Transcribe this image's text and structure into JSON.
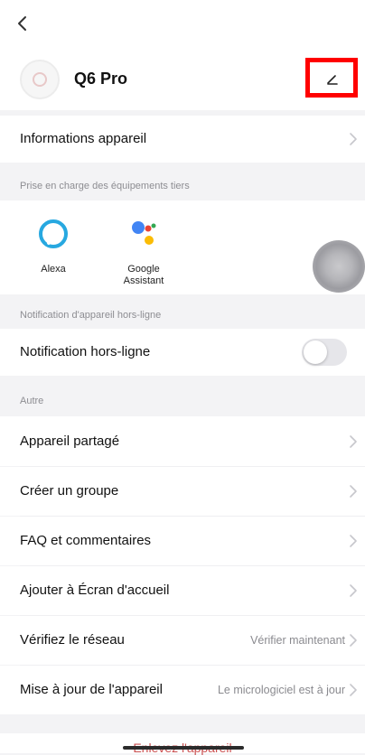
{
  "device": {
    "name": "Q6 Pro"
  },
  "rows": {
    "device_info": "Informations appareil"
  },
  "sections": {
    "third_party": "Prise en charge des équipements tiers",
    "offline": "Notification d'appareil hors-ligne",
    "other": "Autre"
  },
  "third_party_items": [
    {
      "label": "Alexa"
    },
    {
      "label": "Google\nAssistant"
    }
  ],
  "offline_notification": {
    "label": "Notification hors-ligne",
    "enabled": false
  },
  "other_rows": [
    {
      "label": "Appareil partagé",
      "value": ""
    },
    {
      "label": "Créer un groupe",
      "value": ""
    },
    {
      "label": "FAQ et commentaires",
      "value": ""
    },
    {
      "label": "Ajouter à Écran d'accueil",
      "value": ""
    },
    {
      "label": "Vérifiez le réseau",
      "value": "Vérifier maintenant"
    },
    {
      "label": "Mise à jour de l'appareil",
      "value": "Le micrologiciel est à jour"
    }
  ],
  "remove_device": "Enlevez l'appareil",
  "colors": {
    "highlight": "#ff0000",
    "background": "#f3f3f5",
    "alexa": "#27a8e0",
    "google_blue": "#4285f4",
    "google_red": "#ea4335",
    "google_yellow": "#fbbc05",
    "google_green": "#34a853"
  }
}
